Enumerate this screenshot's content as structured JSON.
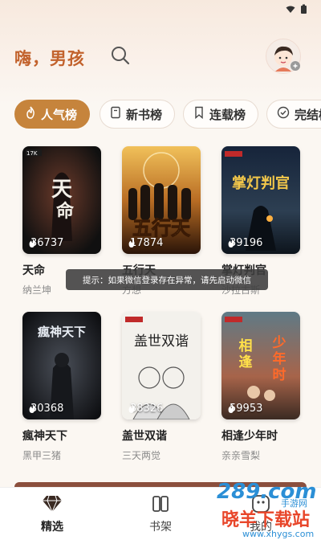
{
  "header": {
    "greeting": "嗨，男孩"
  },
  "tabs": [
    {
      "label": "人气榜",
      "active": true
    },
    {
      "label": "新书榜"
    },
    {
      "label": "连载榜"
    },
    {
      "label": "完结榜"
    }
  ],
  "books": [
    {
      "title": "天命",
      "author": "纳兰坤",
      "heat": "36737",
      "cover_text": "天命"
    },
    {
      "title": "五行天",
      "author": "方想",
      "heat": "17874",
      "cover_text": "五行天"
    },
    {
      "title": "掌灯判官",
      "author": "沙拉古斯",
      "heat": "39196",
      "cover_text": "掌灯判官"
    },
    {
      "title": "瘋神天下",
      "author": "黑甲三猪",
      "heat": "30368",
      "cover_text": "瘋神天下"
    },
    {
      "title": "盖世双谐",
      "author": "三天两觉",
      "heat": "38326",
      "cover_text": "盖世双谐"
    },
    {
      "title": "相逢少年时",
      "author": "亲亲雪梨",
      "heat": "59953",
      "cover_text": "相逢少年时"
    }
  ],
  "toast": {
    "text": "提示：如果微信登录存在异常，请先启动微信"
  },
  "bottom_nav": [
    {
      "label": "精选",
      "active": true
    },
    {
      "label": "书架"
    },
    {
      "label": "我的"
    }
  ],
  "watermark": {
    "line1": "289.com",
    "line2": "手游网",
    "line3": "晓羊下载站",
    "url": "www.xhygs.com"
  },
  "colors": {
    "accent": "#c6843c",
    "greeting": "#c2622c"
  }
}
